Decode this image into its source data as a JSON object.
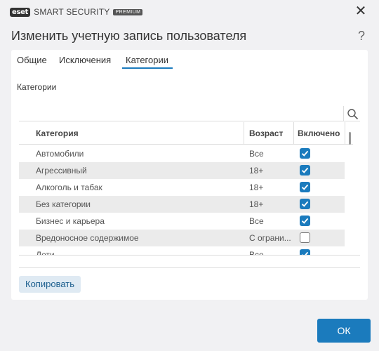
{
  "app": {
    "logo_text": "eset",
    "product": "SMART SECURITY",
    "edition": "PREMIUM"
  },
  "window": {
    "title": "Изменить учетную запись пользователя",
    "help": "?",
    "close": "✕"
  },
  "tabs": [
    {
      "label": "Общие",
      "active": false
    },
    {
      "label": "Исключения",
      "active": false
    },
    {
      "label": "Категории",
      "active": true
    }
  ],
  "section_label": "Категории",
  "search": {
    "value": "",
    "placeholder": ""
  },
  "table": {
    "columns": [
      "Категория",
      "Возраст",
      "Включено"
    ],
    "rows": [
      {
        "category": "Автомобили",
        "age": "Все",
        "enabled": true
      },
      {
        "category": "Агрессивный",
        "age": "18+",
        "enabled": true
      },
      {
        "category": "Алкоголь и табак",
        "age": "18+",
        "enabled": true
      },
      {
        "category": "Без категории",
        "age": "18+",
        "enabled": true
      },
      {
        "category": "Бизнес и карьера",
        "age": "Все",
        "enabled": true
      },
      {
        "category": "Вредоносное содержимое",
        "age": "С ограни...",
        "enabled": false
      },
      {
        "category": "Дети",
        "age": "Все",
        "enabled": true
      }
    ]
  },
  "buttons": {
    "copy": "Копировать",
    "ok": "ОК"
  },
  "colors": {
    "accent": "#1b7bbd",
    "background": "#f1f1f3",
    "row_alt": "#ebebeb"
  }
}
